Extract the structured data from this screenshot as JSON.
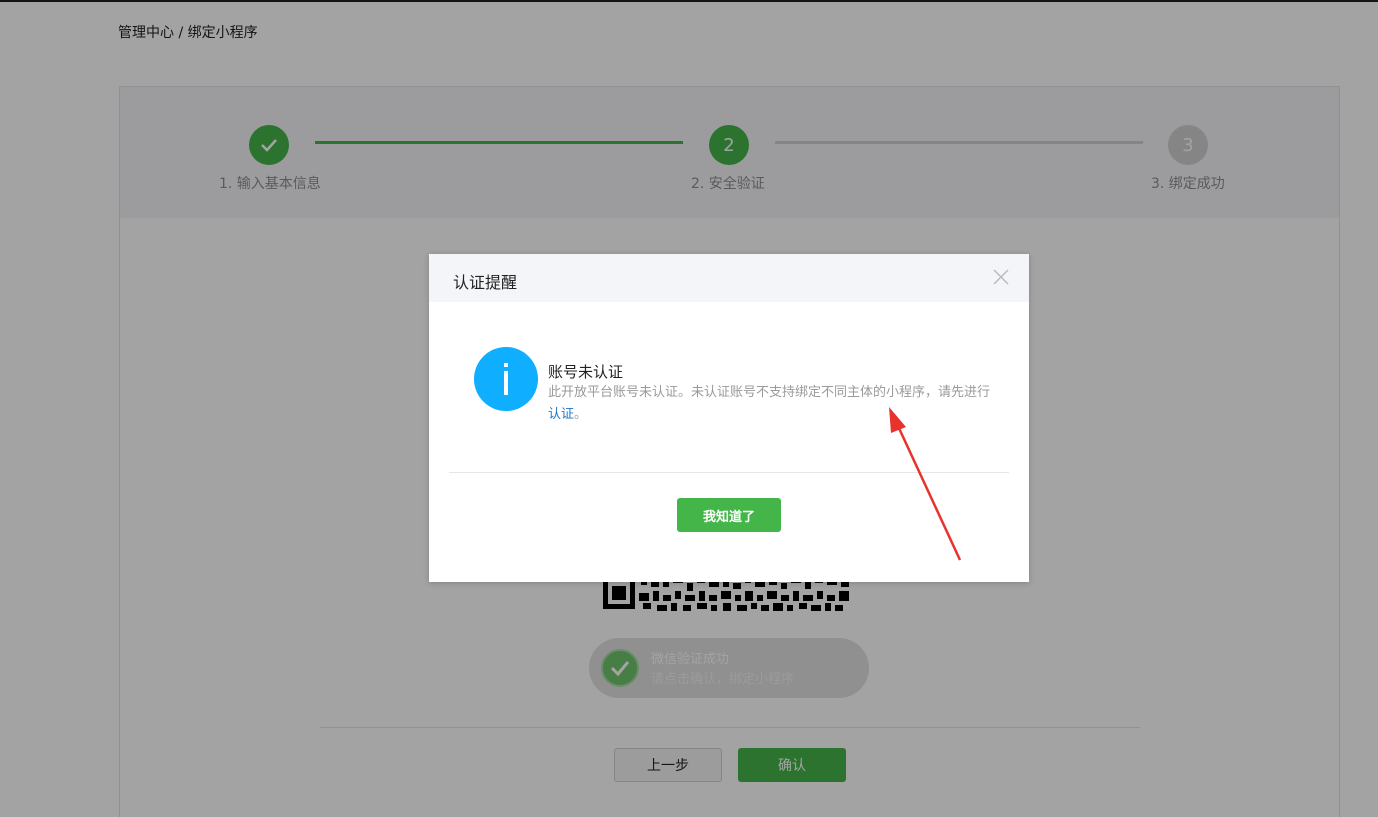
{
  "breadcrumb": {
    "root": "管理中心",
    "separator": " / ",
    "current": "绑定小程序"
  },
  "steps": [
    {
      "number": "1",
      "label": "1. 输入基本信息",
      "state": "done"
    },
    {
      "number": "2",
      "label": "2. 安全验证",
      "state": "current"
    },
    {
      "number": "3",
      "label": "3. 绑定成功",
      "state": "todo"
    }
  ],
  "wechat_status": {
    "title": "微信验证成功",
    "subtitle": "请点击确认，绑定小程序"
  },
  "buttons": {
    "prev": "上一步",
    "confirm": "确认"
  },
  "dialog": {
    "title": "认证提醒",
    "message_title": "账号未认证",
    "message_body": "此开放平台账号未认证。未认证账号不支持绑定不同主体的小程序，请先进行",
    "message_link": "认证",
    "message_end": "。",
    "button": "我知道了"
  },
  "colors": {
    "brand_green": "#44b549",
    "info_blue": "#10aeff",
    "link_blue": "#1a77c7",
    "annotation_red": "#e8322c"
  }
}
